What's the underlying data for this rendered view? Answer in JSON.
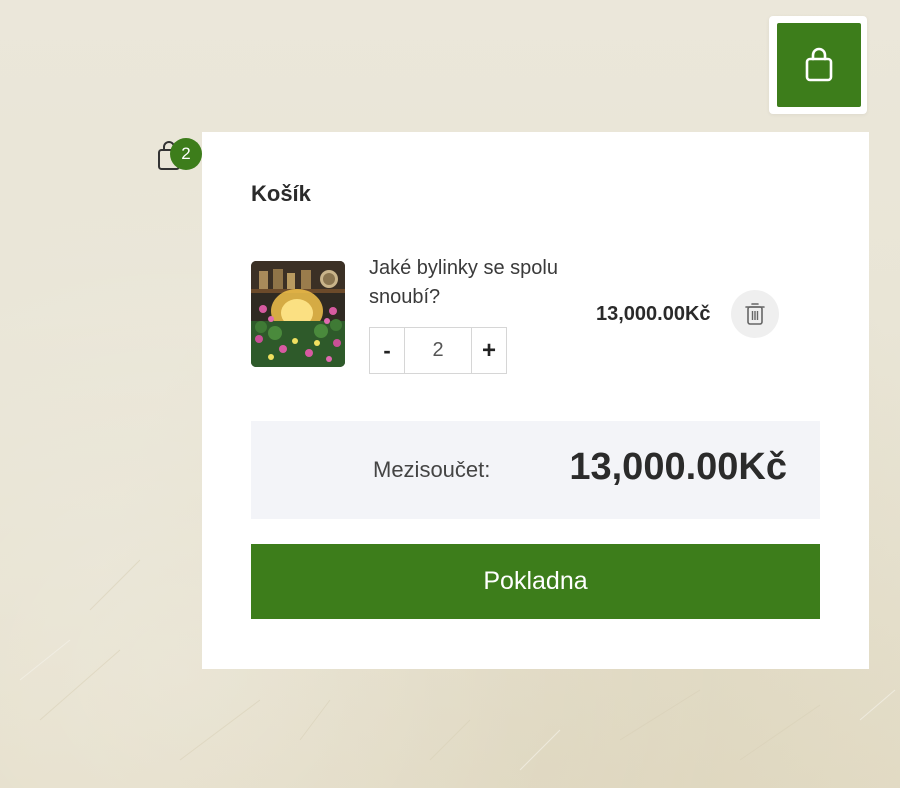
{
  "colors": {
    "accent": "#3d7d1b",
    "panel_background": "#ffffff",
    "subtotal_background": "#f3f4f8"
  },
  "cart_button": {
    "icon": "shopping-bag-icon"
  },
  "mini_cart": {
    "icon": "shopping-bag-icon",
    "count": "2"
  },
  "cart_panel": {
    "title": "Košík",
    "items": [
      {
        "name": "Jaké bylinky se spolu snoubí?",
        "quantity": "2",
        "minus_label": "-",
        "plus_label": "+",
        "price": "13,000.00Kč",
        "thumbnail": "herb-garden-illustration",
        "remove_icon": "trash-icon"
      }
    ],
    "subtotal_label": "Mezisoučet:",
    "subtotal_value": "13,000.00Kč",
    "checkout_label": "Pokladna"
  }
}
